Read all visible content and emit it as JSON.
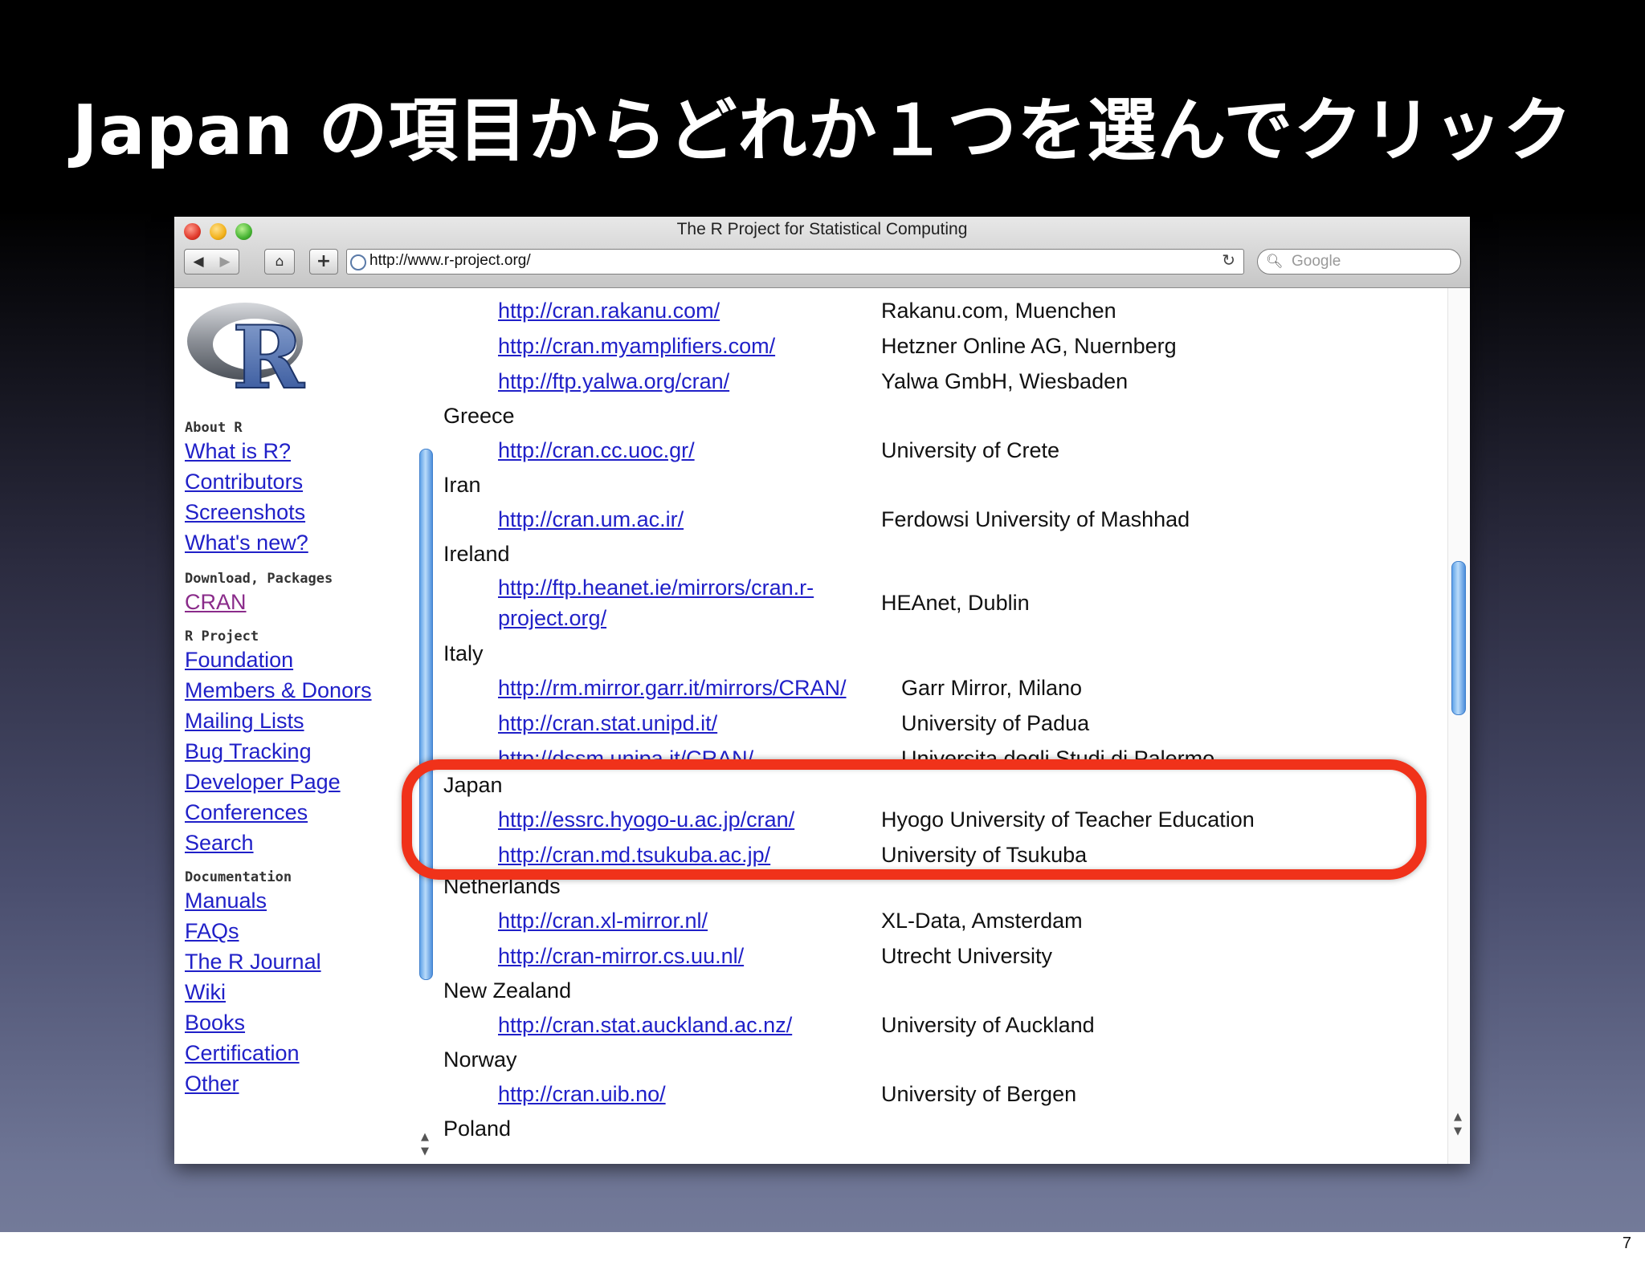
{
  "slide": {
    "title": "Japan の項目からどれか１つを選んでクリック",
    "page_number": "7"
  },
  "browser": {
    "window_title": "The R Project for Statistical Computing",
    "address": "http://www.r-project.org/",
    "search_placeholder": "Google",
    "icons": [
      "back-icon",
      "forward-icon",
      "home-icon",
      "add-bookmark-icon",
      "globe-icon",
      "reload-icon",
      "search-icon"
    ]
  },
  "sidebar": {
    "about_heading": "About R",
    "about_links": [
      "What is R?",
      "Contributors",
      "Screenshots",
      "What's new?"
    ],
    "download_heading": "Download, Packages",
    "download_links": [
      "CRAN"
    ],
    "project_heading": "R Project",
    "project_links": [
      "Foundation",
      "Members & Donors",
      "Mailing Lists",
      "Bug Tracking",
      "Developer Page",
      "Conferences",
      "Search"
    ],
    "doc_heading": "Documentation",
    "doc_links": [
      "Manuals",
      "FAQs",
      "The R Journal",
      "Wiki",
      "Books",
      "Certification",
      "Other"
    ]
  },
  "mirrors": {
    "germany": [
      {
        "url": "http://cran.rakanu.com/",
        "host": "Rakanu.com, Muenchen"
      },
      {
        "url": "http://cran.myamplifiers.com/",
        "host": "Hetzner Online AG, Nuernberg"
      },
      {
        "url": "http://ftp.yalwa.org/cran/",
        "host": "Yalwa GmbH, Wiesbaden"
      }
    ],
    "greece": {
      "name": "Greece",
      "url": "http://cran.cc.uoc.gr/",
      "host": "University of Crete"
    },
    "iran": {
      "name": "Iran",
      "url": "http://cran.um.ac.ir/",
      "host": "Ferdowsi University of Mashhad"
    },
    "ireland": {
      "name": "Ireland",
      "url_line1": "http://ftp.heanet.ie/mirrors/cran.r-",
      "url_line2": "project.org/",
      "host": "HEAnet, Dublin"
    },
    "italy": {
      "name": "Italy",
      "items": [
        {
          "url": "http://rm.mirror.garr.it/mirrors/CRAN/",
          "host": "Garr Mirror, Milano"
        },
        {
          "url": "http://cran.stat.unipd.it/",
          "host": "University of Padua"
        },
        {
          "url": "http://dssm.unipa.it/CRAN/",
          "host": "Universita degli Studi di Palermo"
        }
      ]
    },
    "japan": {
      "name": "Japan",
      "items": [
        {
          "url": "http://essrc.hyogo-u.ac.jp/cran/",
          "host": "Hyogo University of Teacher Education"
        },
        {
          "url": "http://cran.md.tsukuba.ac.jp/",
          "host": "University of Tsukuba"
        }
      ]
    },
    "netherlands": {
      "name": "Netherlands",
      "items": [
        {
          "url": "http://cran.xl-mirror.nl/",
          "host": "XL-Data, Amsterdam"
        },
        {
          "url": "http://cran-mirror.cs.uu.nl/",
          "host": "Utrecht University"
        }
      ]
    },
    "new_zealand": {
      "name": "New Zealand",
      "url": "http://cran.stat.auckland.ac.nz/",
      "host": "University of Auckland"
    },
    "norway": {
      "name": "Norway",
      "url": "http://cran.uib.no/",
      "host": "University of Bergen"
    },
    "poland": {
      "name": "Poland"
    }
  },
  "highlight_color": "#f0321a"
}
